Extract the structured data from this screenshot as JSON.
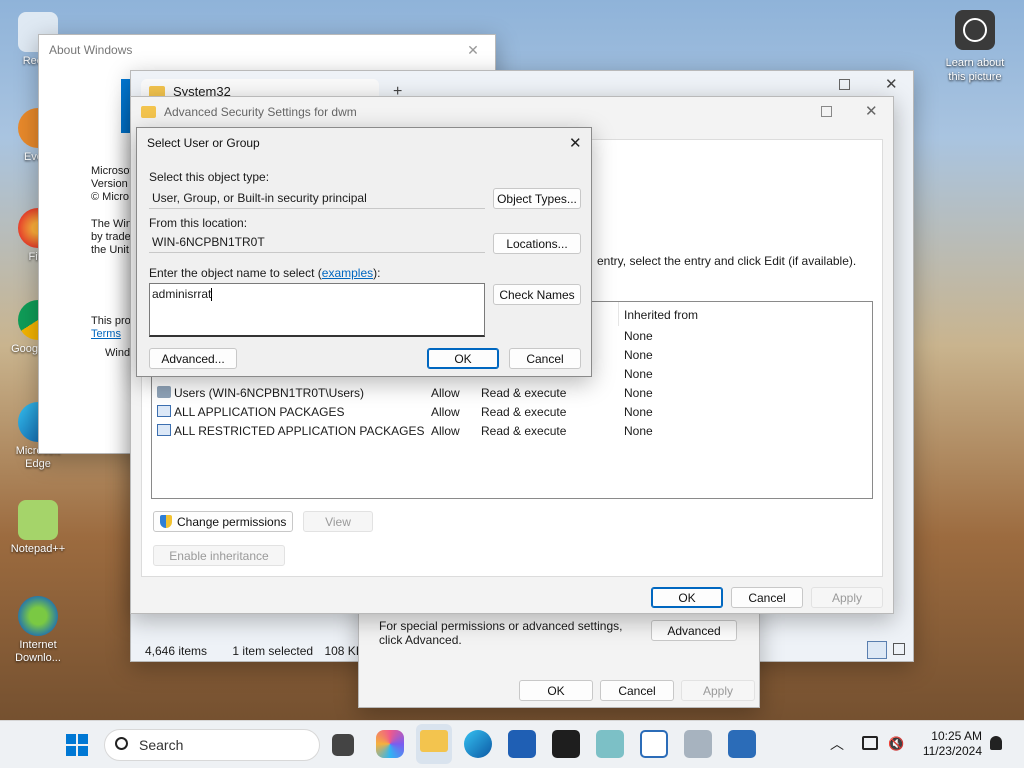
{
  "desktop": {
    "icons": [
      {
        "label": "Recyc"
      },
      {
        "label": "Every"
      },
      {
        "label": "Fire"
      },
      {
        "label": "Goog Chro"
      },
      {
        "label": "Microsoft Edge"
      },
      {
        "label": "Notepad++"
      },
      {
        "label": "Internet Downlo..."
      }
    ],
    "learn_about": "Learn about this picture"
  },
  "about_windows": {
    "title": "About Windows",
    "lines": [
      "Microsof",
      "Version",
      "© Micro",
      "The Win",
      "by trade",
      "the Unit",
      "This pro",
      "Terms",
      "Windo"
    ]
  },
  "explorer": {
    "tab_title": "System32",
    "status": {
      "items": "4,646 items",
      "selected": "1 item selected",
      "size": "108 KB"
    }
  },
  "props_dialog": {
    "special_text": "For special permissions or advanced settings, click Advanced.",
    "advanced_btn": "Advanced",
    "ok": "OK",
    "cancel": "Cancel",
    "apply": "Apply"
  },
  "adv_security": {
    "title": "Advanced Security Settings for dwm",
    "hint": "entry, select the entry and click Edit (if available).",
    "col_inherited": "Inherited from",
    "rows": [
      {
        "principal": "",
        "access": "",
        "perm": "",
        "inherited": "None"
      },
      {
        "principal": "",
        "access": "",
        "perm": "",
        "inherited": "None"
      },
      {
        "principal": "",
        "access": "",
        "perm": "",
        "inherited": "None"
      },
      {
        "principal": "Users (WIN-6NCPBN1TR0T\\Users)",
        "access": "Allow",
        "perm": "Read & execute",
        "inherited": "None"
      },
      {
        "principal": "ALL APPLICATION PACKAGES",
        "access": "Allow",
        "perm": "Read & execute",
        "inherited": "None"
      },
      {
        "principal": "ALL RESTRICTED APPLICATION PACKAGES",
        "access": "Allow",
        "perm": "Read & execute",
        "inherited": "None"
      }
    ],
    "change_permissions": "Change permissions",
    "view": "View",
    "enable_inheritance": "Enable inheritance",
    "ok": "OK",
    "cancel": "Cancel",
    "apply": "Apply"
  },
  "select_user": {
    "title": "Select User or Group",
    "object_type_label": "Select this object type:",
    "object_type_value": "User, Group, or Built-in security principal",
    "object_types_btn": "Object Types...",
    "location_label": "From this location:",
    "location_value": "WIN-6NCPBN1TR0T",
    "locations_btn": "Locations...",
    "enter_label": "Enter the object name to select (",
    "examples_link": "examples",
    "enter_label_end": "):",
    "name_value": "adminisrrat",
    "check_names_btn": "Check Names",
    "advanced_btn": "Advanced...",
    "ok": "OK",
    "cancel": "Cancel"
  },
  "taskbar": {
    "search": "Search",
    "time": "10:25 AM",
    "date": "11/23/2024"
  }
}
